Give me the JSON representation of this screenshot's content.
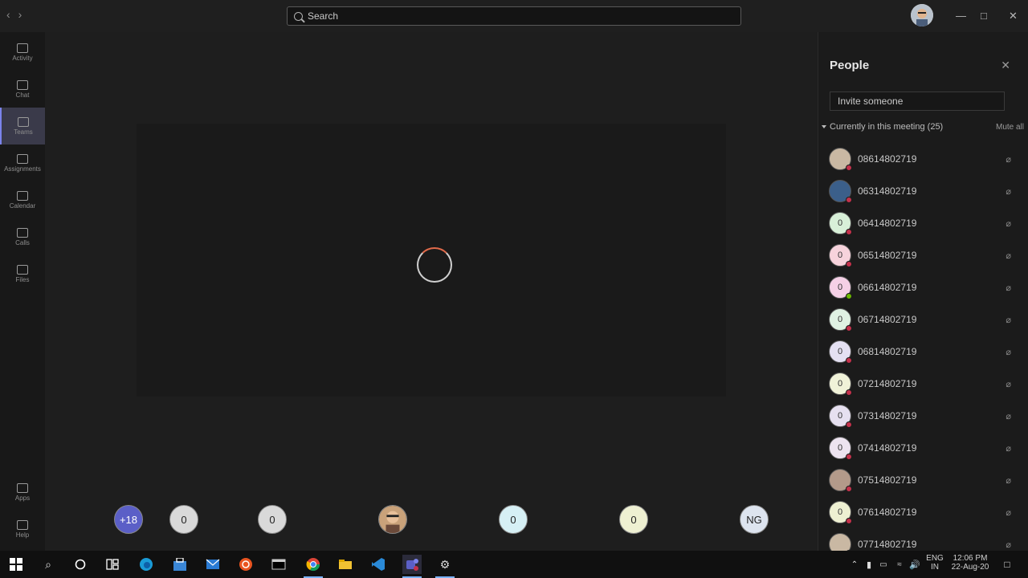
{
  "titlebar": {
    "search_placeholder": "Search",
    "nav_back": "‹",
    "nav_forward": "›",
    "minimize": "—",
    "maximize": "□",
    "close": "✕"
  },
  "rail": {
    "items": [
      {
        "label": "Activity",
        "icon": "bell-icon"
      },
      {
        "label": "Chat",
        "icon": "chat-icon"
      },
      {
        "label": "Teams",
        "icon": "teams-icon",
        "active": true
      },
      {
        "label": "Assignments",
        "icon": "assignments-icon"
      },
      {
        "label": "Calendar",
        "icon": "calendar-icon"
      },
      {
        "label": "Calls",
        "icon": "phone-icon"
      },
      {
        "label": "Files",
        "icon": "files-icon"
      },
      {
        "label": "Apps",
        "icon": "apps-icon"
      },
      {
        "label": "Help",
        "icon": "help-icon"
      }
    ]
  },
  "strip": {
    "items": [
      {
        "text": "+18",
        "color": "#5b5fc7",
        "text_color": "#ffffff"
      },
      {
        "text": "0",
        "color": "#d9d9d9"
      },
      {
        "text": "0",
        "color": "#d9d9d9"
      },
      {
        "text": "",
        "color": "#c9a27a",
        "kind": "photo"
      },
      {
        "text": "0",
        "color": "#d6f0f5"
      },
      {
        "text": "0",
        "color": "#eef0d2"
      },
      {
        "text": "NG",
        "color": "#dde4ef"
      }
    ]
  },
  "panel": {
    "title": "People",
    "close": "✕",
    "invite_placeholder": "Invite someone",
    "section_label": "Currently in this meeting (25)",
    "mute_all": "Mute all",
    "participants": [
      {
        "name": "08614802719",
        "avatar": "",
        "color": "#c9b8a3",
        "presence": "#c4314b"
      },
      {
        "name": "06314802719",
        "avatar": "",
        "color": "#3b5f8a",
        "presence": "#c4314b"
      },
      {
        "name": "06414802719",
        "avatar": "0",
        "color": "#d8f0d8",
        "presence": "#c4314b"
      },
      {
        "name": "06514802719",
        "avatar": "0",
        "color": "#f7d3dc",
        "presence": "#c4314b"
      },
      {
        "name": "06614802719",
        "avatar": "0",
        "color": "#f5d0e6",
        "presence": "#6bb700"
      },
      {
        "name": "06714802719",
        "avatar": "0",
        "color": "#dff2e3",
        "presence": "#c4314b"
      },
      {
        "name": "06814802719",
        "avatar": "0",
        "color": "#e4e0f2",
        "presence": "#c4314b"
      },
      {
        "name": "07214802719",
        "avatar": "0",
        "color": "#f0f2d8",
        "presence": "#c4314b"
      },
      {
        "name": "07314802719",
        "avatar": "0",
        "color": "#e6e0f0",
        "presence": "#c4314b"
      },
      {
        "name": "07414802719",
        "avatar": "0",
        "color": "#ede3f0",
        "presence": "#c4314b"
      },
      {
        "name": "07514802719",
        "avatar": "",
        "color": "#b39a8a",
        "presence": "#c4314b"
      },
      {
        "name": "07614802719",
        "avatar": "0",
        "color": "#eef0d2",
        "presence": "#c4314b"
      },
      {
        "name": "07714802719",
        "avatar": "",
        "color": "#c9b8a3",
        "presence": "#c4314b"
      }
    ]
  },
  "taskbar": {
    "lang": "ENG",
    "region": "IN",
    "time": "12:06 PM",
    "date": "22-Aug-20"
  }
}
